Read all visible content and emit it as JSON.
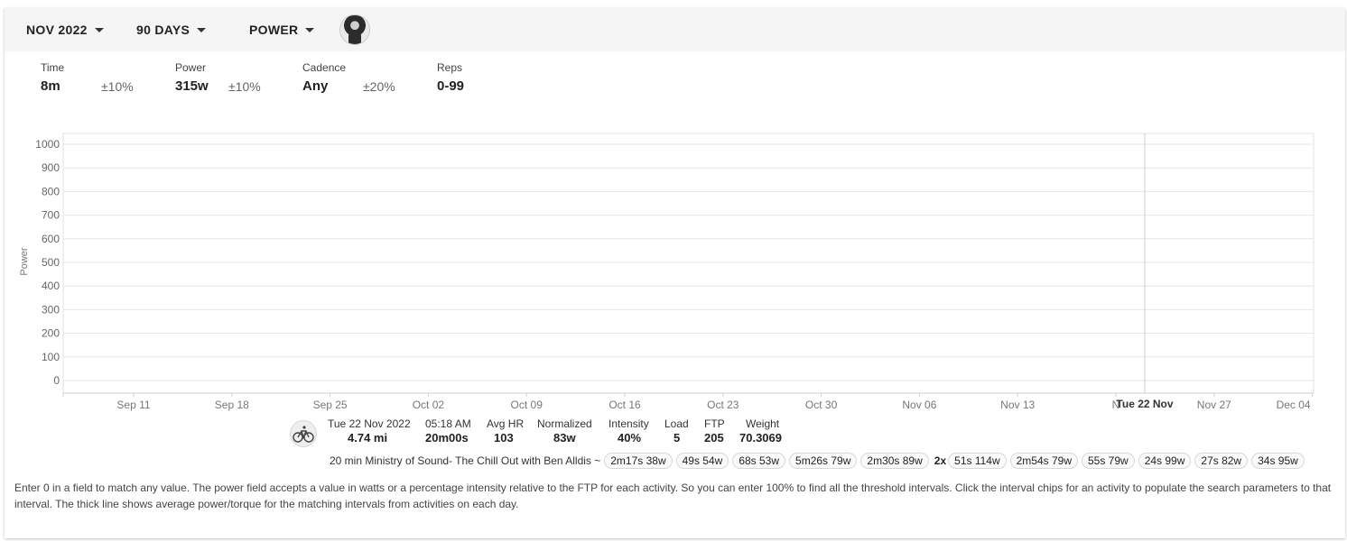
{
  "toolbar": {
    "month_label": "NOV 2022",
    "range_label": "90 DAYS",
    "metric_label": "POWER",
    "avatar_icon": "user-avatar"
  },
  "params": {
    "time": {
      "label": "Time",
      "value": "8m",
      "tolerance": "±10%"
    },
    "power": {
      "label": "Power",
      "value": "315w",
      "tolerance": "±10%"
    },
    "cadence": {
      "label": "Cadence",
      "value": "Any",
      "tolerance": "±20%"
    },
    "reps": {
      "label": "Reps",
      "value": "0-99"
    }
  },
  "chart_data": {
    "type": "line",
    "ylabel": "Power",
    "ylim": [
      0,
      1000
    ],
    "y_ticks": [
      "0",
      "100",
      "200",
      "300",
      "400",
      "500",
      "600",
      "700",
      "800",
      "900",
      "1000"
    ],
    "x_ticks": [
      "Sep 11",
      "Sep 18",
      "Sep 25",
      "Oct 02",
      "Oct 09",
      "Oct 16",
      "Oct 23",
      "Oct 30",
      "Nov 06",
      "Nov 13",
      "N",
      "Nov 27",
      "Dec 04"
    ],
    "cursor_label": "Tue 22 Nov",
    "series": [],
    "grid": true
  },
  "activity": {
    "date_label": "Tue 22 Nov 2022",
    "distance": "4.74 mi",
    "time_label": "05:18 AM",
    "duration": "20m00s",
    "avghr_label": "Avg HR",
    "avghr": "103",
    "normalized_label": "Normalized",
    "normalized": "83w",
    "intensity_label": "Intensity",
    "intensity": "40%",
    "load_label": "Load",
    "load": "5",
    "ftp_label": "FTP",
    "ftp": "205",
    "weight_label": "Weight",
    "weight": "70.3069",
    "name": "20 min Ministry of Sound- The Chill Out with Ben Alldis ~",
    "sport_icon": "cycling-icon"
  },
  "intervals": [
    {
      "count": "",
      "label": "2m17s 38w"
    },
    {
      "count": "",
      "label": "49s 54w"
    },
    {
      "count": "",
      "label": "68s 53w"
    },
    {
      "count": "",
      "label": "5m26s 79w"
    },
    {
      "count": "",
      "label": "2m30s 89w"
    },
    {
      "count": "2x",
      "label": "51s 114w"
    },
    {
      "count": "",
      "label": "2m54s 79w"
    },
    {
      "count": "",
      "label": "55s 79w"
    },
    {
      "count": "",
      "label": "24s 99w"
    },
    {
      "count": "",
      "label": "27s 82w"
    },
    {
      "count": "",
      "label": "34s 95w"
    }
  ],
  "help_text": "Enter 0 in a field to match any value. The power field accepts a value in watts or a percentage intensity relative to the FTP for each activity. So you can enter 100% to find all the threshold intervals. Click the interval chips for an activity to populate the search parameters to that interval. The thick line shows average power/torque for the matching intervals from activities on each day."
}
